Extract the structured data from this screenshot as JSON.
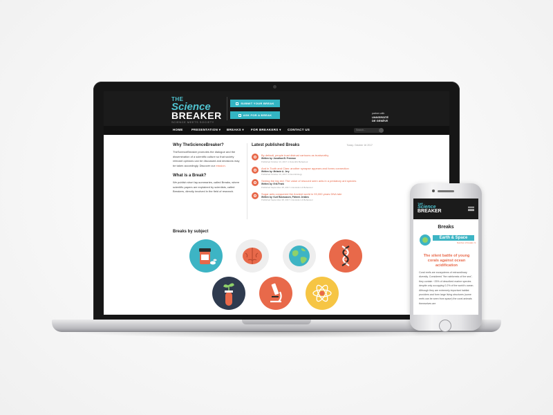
{
  "site": {
    "logo": {
      "line1": "THE",
      "line2": "Science",
      "line3": "BREAKER",
      "tagline": "SCIENCE MEETS SOCIETY"
    },
    "buttons": [
      {
        "label": "SUBMIT YOUR BREAK"
      },
      {
        "label": "ASK FOR A BREAK"
      }
    ],
    "partner": {
      "label": "partner with",
      "name": "UNIVERSITÉ",
      "name2": "DE GENÈVE"
    },
    "nav": [
      {
        "label": "HOME"
      },
      {
        "label": "PRESENTATION ▾"
      },
      {
        "label": "BREAKS ▾"
      },
      {
        "label": "FOR BREAKERS ▾"
      },
      {
        "label": "CONTACT US"
      }
    ],
    "search_placeholder": "Search...",
    "why": {
      "title": "Why TheScienceBreaker?",
      "text": "TheScienceBreaker promotes the dialogue and the dissemination of a scientific culture so that society relevant opinions can be discussed and decisions may be taken accordingly. Discover our ",
      "link": "mission."
    },
    "what": {
      "title": "What is a Break?",
      "text": "We publish short lay-summaries, called Breaks, where scientific papers are explained by scientists, called Breakers, directly involved in the field of research."
    },
    "latest": {
      "title": "Latest published Breaks",
      "date": "Today: October 16 2017",
      "items": [
        {
          "title": "By default, people trust distrust cartoons as trustworthy",
          "author": "Written by: Jonathan B. Freeman",
          "pub": "Published October 13, 2017 in Scientific Behaviour"
        },
        {
          "title": "And in Tooth and Claw: another synapse appears and forms connection",
          "author": "Written by: Melanie A. Jery",
          "pub": "Published October 13, 2017 in Neurobiology"
        },
        {
          "title": "Seeing the big red: The value of rescued seen ants in a predatory ant species",
          "author": "Written by: Erik Frank",
          "pub": "Published September 28, 2017 in Evolution & Behaviour"
        },
        {
          "title": "Sugar ants conquered the Ancient world in 93,000 years DNA tale",
          "author": "Written by: Kurt Rasmussen, Pieterni Jenkins",
          "pub": "Published September 28, 2017 in Evolution & Behaviour"
        }
      ]
    },
    "subjects_title": "Breaks by subject",
    "subjects": [
      {
        "icon": "pills-icon"
      },
      {
        "icon": "brain-icon"
      },
      {
        "icon": "earth-icon"
      },
      {
        "icon": "dna-icon"
      },
      {
        "icon": "plant-tube-icon"
      },
      {
        "icon": "microscope-icon"
      },
      {
        "icon": "atom-icon"
      }
    ]
  },
  "phone": {
    "logo": {
      "line1": "THE",
      "line2": "Science",
      "line3": "BREAKER"
    },
    "section": "Breaks",
    "subject": "Earth & Space",
    "subject_sub": "Number of breaks: 9",
    "title": "The silent battle of young corals against ocean acidification",
    "body": "Coral reefs are ecosystems of extraordinary diversity. Considered \"the rainforests of the sea\", they contain ~25% of described marine species despite only occupying 0.2% of the world's ocean. Although they are extremely important habitat providers and form large living structures (some reefs can be seen from space) the coral animals themselves are"
  },
  "colors": {
    "accent": "#33b5c3",
    "orange": "#e8694a",
    "header": "#1b1b1b"
  }
}
